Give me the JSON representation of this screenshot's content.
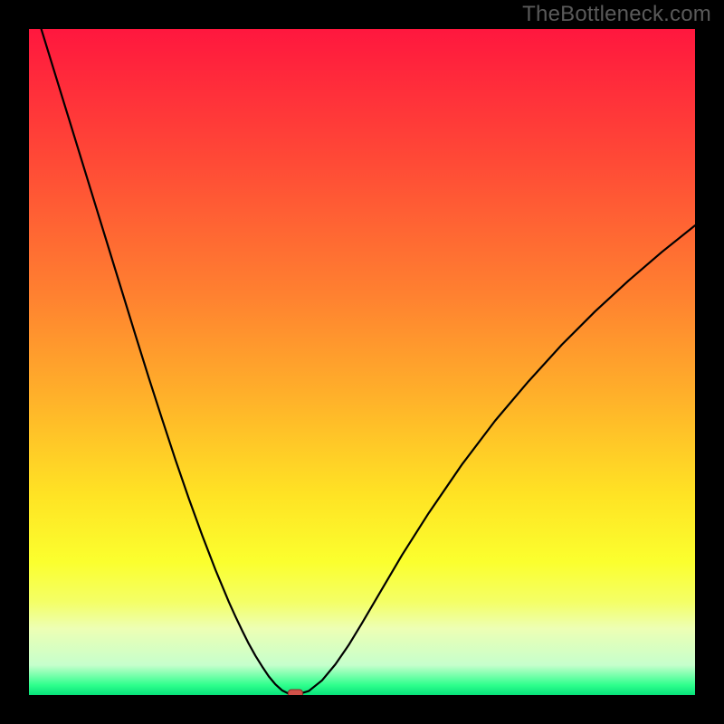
{
  "watermark": "TheBottleneck.com",
  "colors": {
    "frame": "#000000",
    "curve": "#000000",
    "marker_fill": "#d2524a",
    "marker_stroke": "#8a2e28",
    "gradient_stops": [
      {
        "offset": 0.0,
        "color": "#ff173e"
      },
      {
        "offset": 0.2,
        "color": "#ff4a36"
      },
      {
        "offset": 0.4,
        "color": "#ff8130"
      },
      {
        "offset": 0.55,
        "color": "#ffb02a"
      },
      {
        "offset": 0.7,
        "color": "#ffe324"
      },
      {
        "offset": 0.8,
        "color": "#fbff2e"
      },
      {
        "offset": 0.86,
        "color": "#f4ff66"
      },
      {
        "offset": 0.9,
        "color": "#edffb4"
      },
      {
        "offset": 0.955,
        "color": "#c6ffcc"
      },
      {
        "offset": 0.985,
        "color": "#2fff8d"
      },
      {
        "offset": 1.0,
        "color": "#07e27a"
      }
    ]
  },
  "chart_data": {
    "type": "line",
    "title": "",
    "xlabel": "",
    "ylabel": "",
    "xlim": [
      0,
      100
    ],
    "ylim": [
      0,
      100
    ],
    "x": [
      0,
      2,
      4,
      6,
      8,
      10,
      12,
      14,
      16,
      18,
      20,
      22,
      24,
      26,
      28,
      30,
      31,
      32,
      33,
      34,
      35,
      36,
      37,
      38,
      39,
      40,
      42,
      44,
      46,
      48,
      50,
      53,
      56,
      60,
      65,
      70,
      75,
      80,
      85,
      90,
      95,
      100
    ],
    "values": [
      106,
      99.5,
      93,
      86.5,
      80,
      73.5,
      67,
      60.5,
      54,
      47.6,
      41.4,
      35.3,
      29.5,
      24,
      18.8,
      14,
      11.8,
      9.7,
      7.7,
      5.9,
      4.3,
      2.8,
      1.6,
      0.7,
      0.2,
      0,
      0.6,
      2.2,
      4.6,
      7.5,
      10.8,
      15.9,
      21,
      27.3,
      34.6,
      41.2,
      47.1,
      52.6,
      57.6,
      62.2,
      66.5,
      70.5
    ],
    "marker": {
      "x": 40,
      "y": 0
    },
    "grid": false,
    "legend": false
  }
}
